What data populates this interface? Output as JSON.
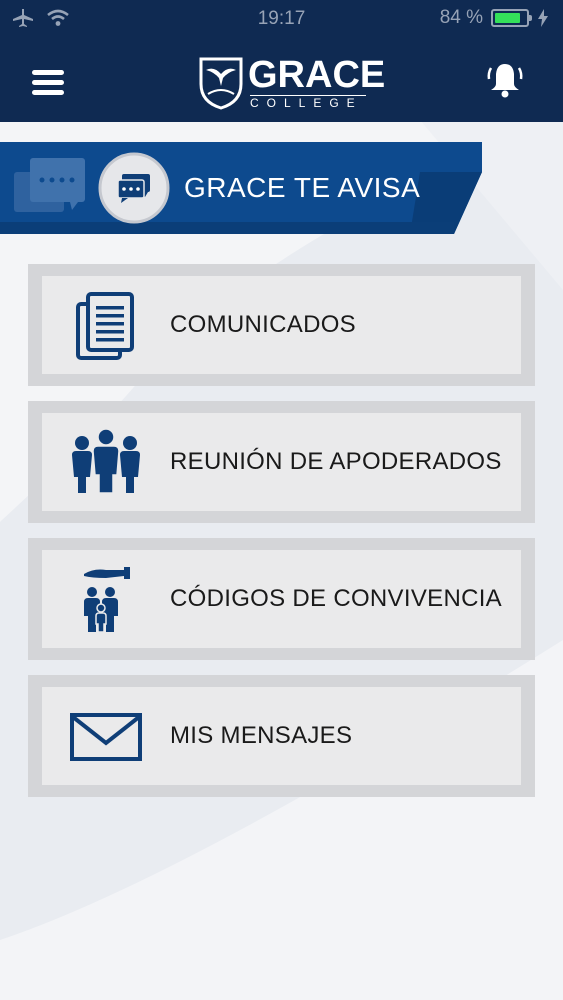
{
  "status_bar": {
    "time": "19:17",
    "battery": "84 %",
    "battery_level": 0.84,
    "icons": [
      "airplane-icon",
      "wifi-icon",
      "charging-icon"
    ]
  },
  "header": {
    "logo_word": "GRACE",
    "logo_sub": "COLLEGE",
    "menu_icon": "hamburger-icon",
    "notification_icon": "bell-icon"
  },
  "banner": {
    "title": "GRACE TE AVISA",
    "icon": "chat-bubble-icon"
  },
  "menu": {
    "items": [
      {
        "label": "COMUNICADOS",
        "icon": "documents-icon"
      },
      {
        "label": "REUNIÓN DE APODERADOS",
        "icon": "people-group-icon"
      },
      {
        "label": "CÓDIGOS DE CONVIVENCIA",
        "icon": "family-protection-icon"
      },
      {
        "label": "MIS MENSAJES",
        "icon": "envelope-icon"
      }
    ]
  },
  "colors": {
    "header": "#0f2a52",
    "banner": "#0d4a8e",
    "accent": "#0f3e77",
    "card_border": "#d4d5d8",
    "card_fill": "#eaeaeb",
    "battery": "#34e05a"
  }
}
